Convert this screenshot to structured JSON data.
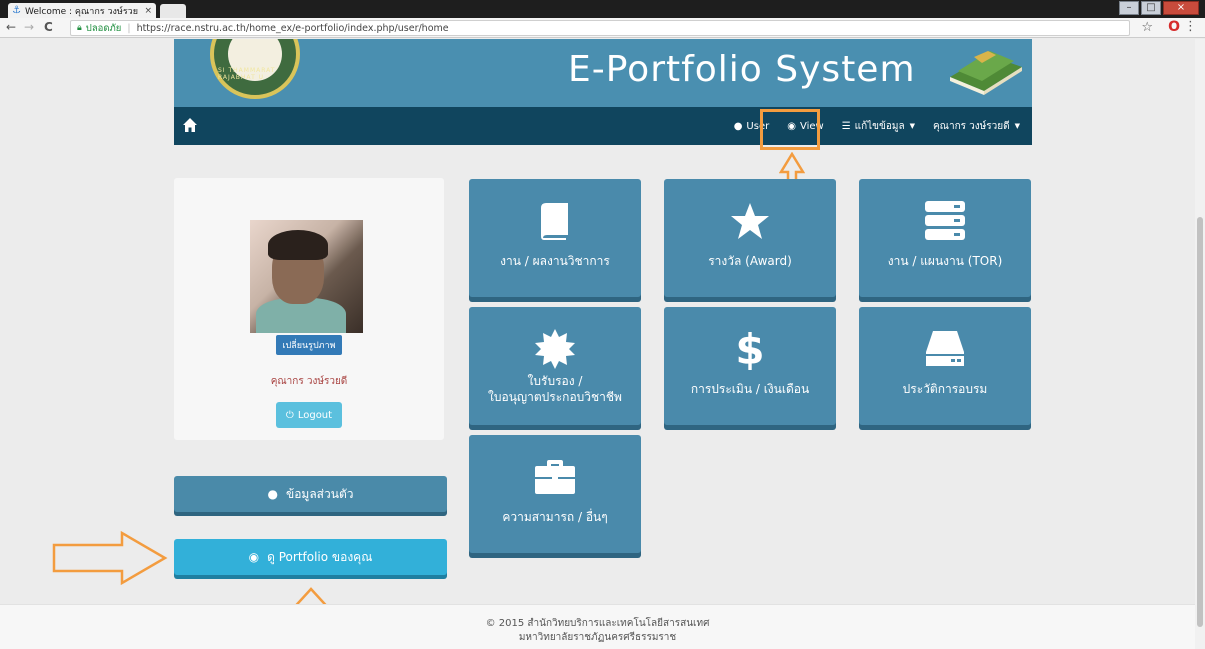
{
  "browser": {
    "tab_title": "Welcome : คุณากร วงษ์รวย",
    "tab_close": "×",
    "secure_label": "ปลอดภัย",
    "url": "https://race.nstru.ac.th/home_ex/e-portfolio/index.php/user/home",
    "back": "←",
    "forward": "→",
    "reload": "C",
    "bookmark": "☆",
    "opera": "O",
    "menu": "⋮"
  },
  "header": {
    "title": "E-Portfolio System",
    "logo_ring_text": "SI THAMMARAT RAJABHAT U"
  },
  "navbar": {
    "user_label": "User",
    "view_label": "View",
    "edit_label": "แก้ไขข้อมูล",
    "account_label": "คุณากร วงษ์รวยดี"
  },
  "profile": {
    "change_photo_label": "เปลี่ยนรูปภาพ",
    "name": "คุณากร วงษ์รวยดี",
    "logout_label": "Logout"
  },
  "sidebar": {
    "personal_label": "ข้อมูลส่วนตัว",
    "portfolio_label": "ดู Portfolio ของคุณ"
  },
  "tiles": [
    {
      "label": "งาน / ผลงานวิชาการ",
      "icon": "book-icon"
    },
    {
      "label": "รางวัล (Award)",
      "icon": "star-icon"
    },
    {
      "label": "งาน / แผนงาน (TOR)",
      "icon": "server-icon"
    },
    {
      "label1": "ใบรับรอง /",
      "label2": "ใบอนุญาตประกอบวิชาชีพ",
      "icon": "certificate-icon"
    },
    {
      "label": "การประเมิน / เงินเดือน",
      "icon": "dollar-icon"
    },
    {
      "label": "ประวัติการอบรม",
      "icon": "hdd-icon"
    },
    {
      "label": "ความสามารถ / อื่นๆ",
      "icon": "briefcase-icon"
    }
  ],
  "footer": {
    "line1": "© 2015 สำนักวิทยบริการและเทคโนโลยีสารสนเทศ",
    "line2": "มหาวิทยาลัยราชภัฏนครศรีธรรมราช"
  },
  "colors": {
    "banner": "#4a8fb0",
    "navbar": "#10455e",
    "tile": "#4a8aab",
    "annotation": "#f39c3f"
  }
}
